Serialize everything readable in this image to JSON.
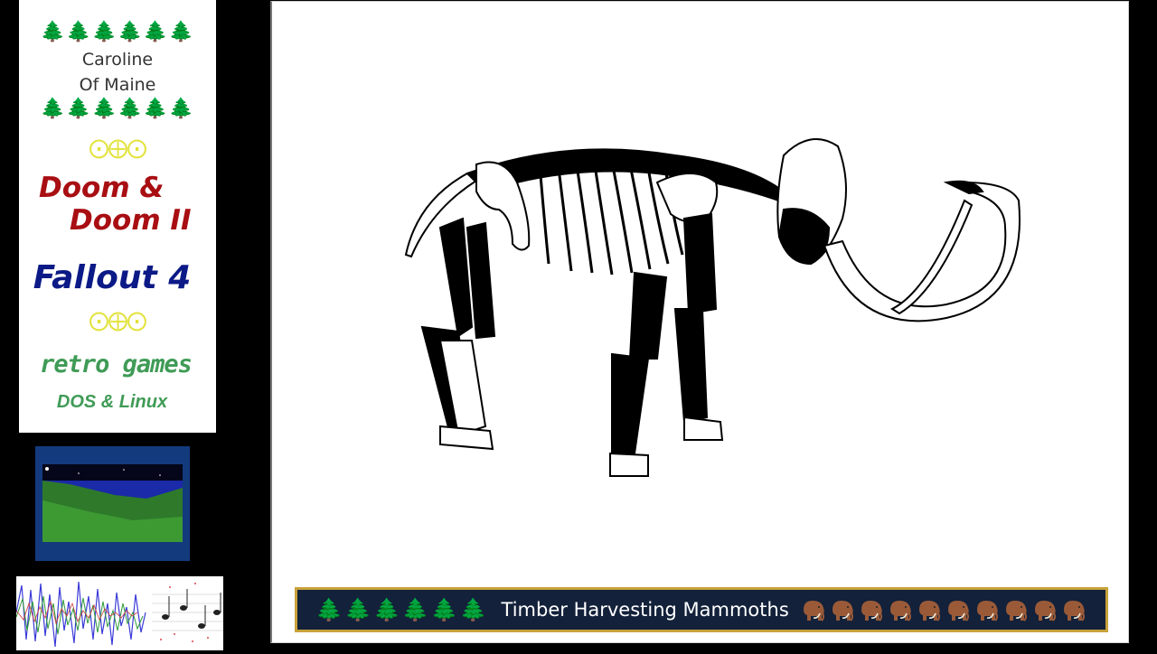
{
  "side_panel": {
    "tree_glyphs": "🌲🌲🌲🌲🌲🌲",
    "streamer_line_1": "Caroline",
    "streamer_line_2": "Of Maine",
    "symbols": "⨀⨁⨀",
    "game_1_line_1": "Doom &",
    "game_1_line_2": "Doom II",
    "game_2": "Fallout 4",
    "retro_label": "retro games",
    "os_label": "DOS & Linux",
    "colors": {
      "doom": "#a80e12",
      "fallout": "#0b1a86",
      "retro": "#3f9b56",
      "trees": "#14873a",
      "symbols": "#e2e23a"
    }
  },
  "banner": {
    "trees": "🌲🌲🌲🌲🌲🌲",
    "title": "Timber Harvesting Mammoths",
    "mammoth_icon": "mammoth-icon",
    "mammoth_count": 10,
    "colors": {
      "background": "#13213a",
      "border": "#c8a23a",
      "text": "#ffffff"
    }
  },
  "main_image": {
    "icon": "mammoth-skeleton-illustration"
  }
}
